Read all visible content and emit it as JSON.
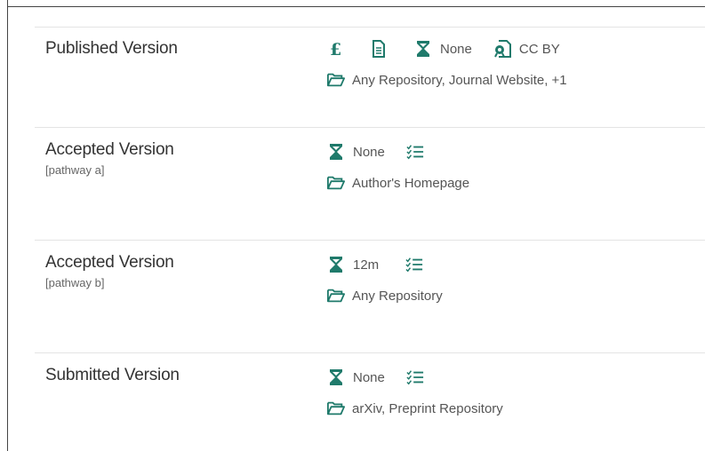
{
  "rows": [
    {
      "title": "Published Version",
      "pathway": "",
      "embargo": "None",
      "license": "CC BY",
      "locations": "Any Repository, Journal Website, +1",
      "icons": [
        "pound-fee-icon",
        "document-icon",
        "hourglass-icon",
        "license-icon",
        "folder-icon"
      ]
    },
    {
      "title": "Accepted Version",
      "pathway": "[pathway a]",
      "embargo": "None",
      "locations": "Author's Homepage",
      "icons": [
        "hourglass-icon",
        "conditions-list-icon",
        "folder-icon"
      ]
    },
    {
      "title": "Accepted Version",
      "pathway": "[pathway b]",
      "embargo": "12m",
      "locations": "Any Repository",
      "icons": [
        "hourglass-icon",
        "conditions-list-icon",
        "folder-icon"
      ]
    },
    {
      "title": "Submitted Version",
      "pathway": "",
      "embargo": "None",
      "locations": "arXiv, Preprint Repository",
      "icons": [
        "hourglass-icon",
        "conditions-list-icon",
        "folder-icon"
      ]
    }
  ],
  "colors": {
    "accent": "#1f7a6b",
    "divider": "#e4e4e4",
    "title": "#333333",
    "text": "#555555"
  }
}
